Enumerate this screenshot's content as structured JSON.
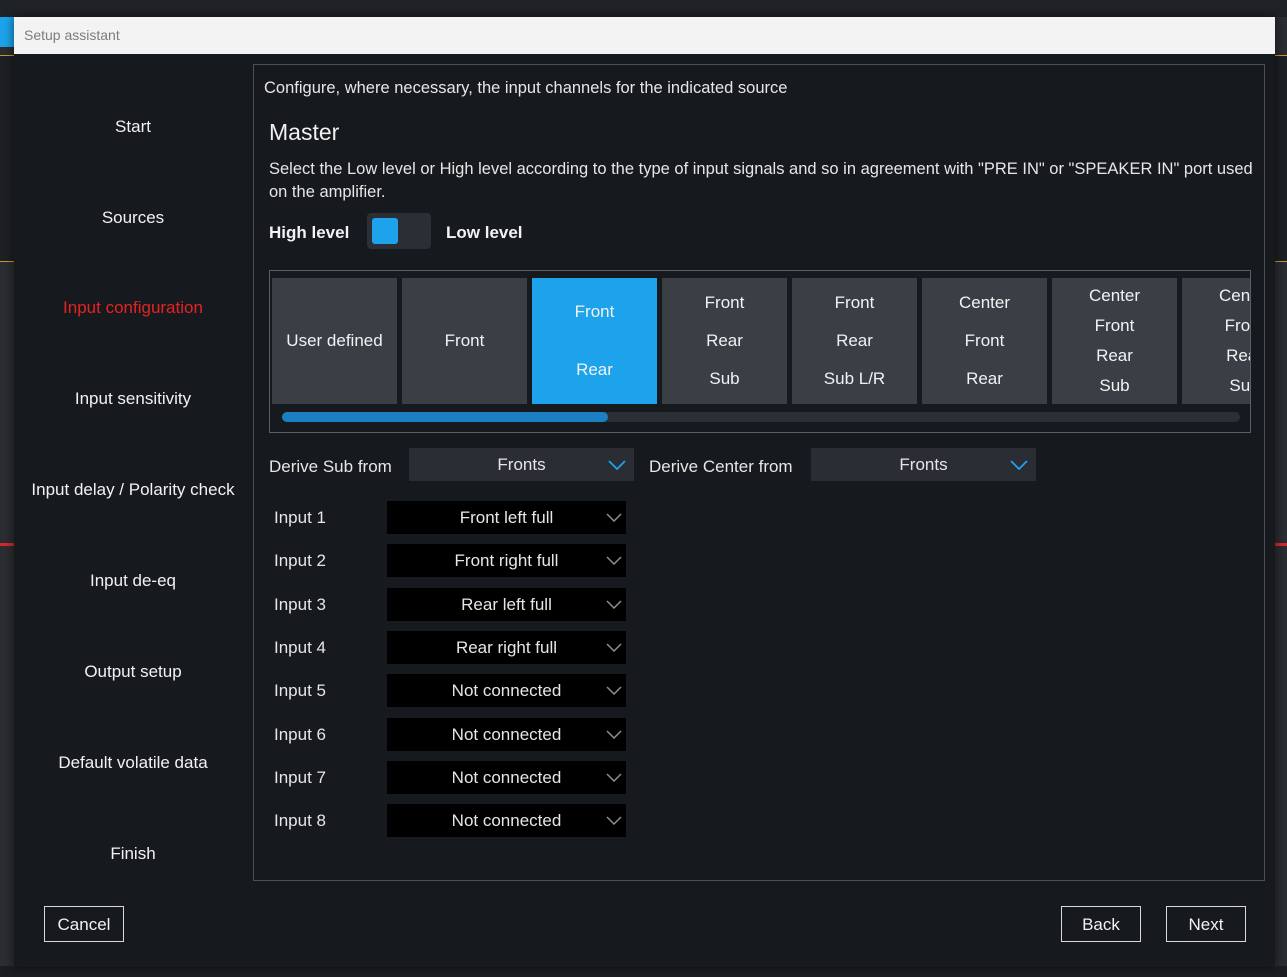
{
  "dialog": {
    "title": "Setup assistant"
  },
  "sidebar": {
    "items": [
      {
        "label": "Start",
        "active": false
      },
      {
        "label": "Sources",
        "active": false
      },
      {
        "label": "Input configuration",
        "active": true
      },
      {
        "label": "Input sensitivity",
        "active": false
      },
      {
        "label": "Input delay / Polarity check",
        "active": false
      },
      {
        "label": "Input de-eq",
        "active": false
      },
      {
        "label": "Output setup",
        "active": false
      },
      {
        "label": "Default volatile data",
        "active": false
      },
      {
        "label": "Finish",
        "active": false
      }
    ]
  },
  "main": {
    "instruction": "Configure, where necessary, the input channels for the indicated source",
    "section_title": "Master",
    "description": "Select the Low level or High level according to the type of input signals and so in agreement with \"PRE IN\" or \"SPEAKER IN\" port used on the amplifier.",
    "level": {
      "high_label": "High level",
      "low_label": "Low level",
      "selected": "High level"
    },
    "presets": [
      {
        "lines": [
          "User defined"
        ],
        "selected": false
      },
      {
        "lines": [
          "Front"
        ],
        "selected": false
      },
      {
        "lines": [
          "Front",
          "Rear"
        ],
        "selected": true
      },
      {
        "lines": [
          "Front",
          "Rear",
          "Sub"
        ],
        "selected": false
      },
      {
        "lines": [
          "Front",
          "Rear",
          "Sub L/R"
        ],
        "selected": false
      },
      {
        "lines": [
          "Center",
          "Front",
          "Rear"
        ],
        "selected": false
      },
      {
        "lines": [
          "Center",
          "Front",
          "Rear",
          "Sub"
        ],
        "selected": false
      },
      {
        "lines": [
          "Center",
          "Front",
          "Rear",
          "Sub"
        ],
        "selected": false
      }
    ],
    "presets_scroll_fraction": 0.34,
    "derive_sub": {
      "label": "Derive Sub from",
      "value": "Fronts"
    },
    "derive_center": {
      "label": "Derive Center from",
      "value": "Fronts"
    },
    "inputs": [
      {
        "label": "Input 1",
        "value": "Front left full"
      },
      {
        "label": "Input 2",
        "value": "Front right full"
      },
      {
        "label": "Input 3",
        "value": "Rear left full"
      },
      {
        "label": "Input 4",
        "value": "Rear right full"
      },
      {
        "label": "Input 5",
        "value": "Not connected"
      },
      {
        "label": "Input 6",
        "value": "Not connected"
      },
      {
        "label": "Input 7",
        "value": "Not connected"
      },
      {
        "label": "Input 8",
        "value": "Not connected"
      }
    ]
  },
  "footer": {
    "cancel_label": "Cancel",
    "back_label": "Back",
    "next_label": "Next"
  },
  "colors": {
    "accent": "#1ca3ec",
    "active_nav": "#e52323",
    "background": "#16191d"
  }
}
